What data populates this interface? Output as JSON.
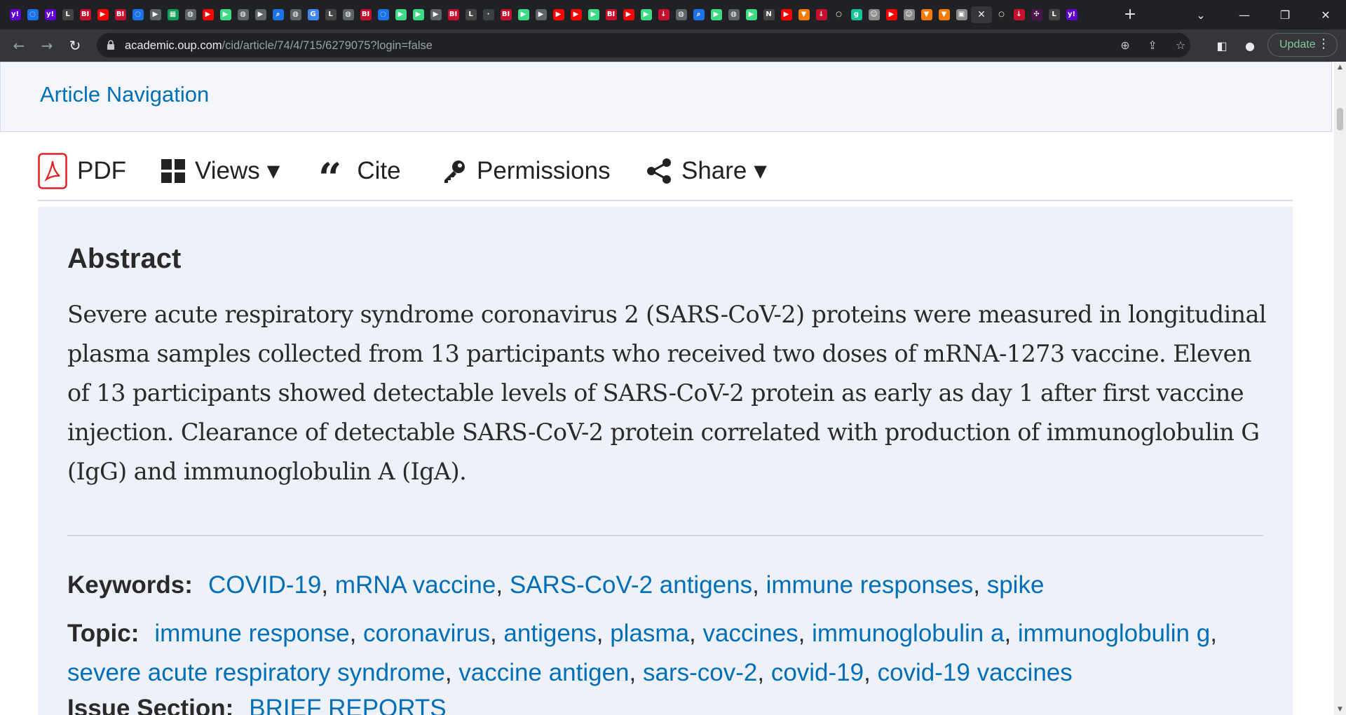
{
  "browser": {
    "tabs": [
      {
        "icon": "yahoo-icon",
        "glyph": "y!",
        "bg": "#6001d2"
      },
      {
        "icon": "shield-icon",
        "glyph": "◌",
        "bg": "#1a73e8"
      },
      {
        "icon": "yahoo-icon",
        "glyph": "y!",
        "bg": "#6001d2"
      },
      {
        "icon": "latimes-icon",
        "glyph": "L",
        "bg": "#444"
      },
      {
        "icon": "business-insider-icon",
        "glyph": "BI",
        "bg": "#c8102e"
      },
      {
        "icon": "youtube-icon",
        "glyph": "▶",
        "bg": "#ff0000"
      },
      {
        "icon": "business-insider-icon",
        "glyph": "BI",
        "bg": "#c8102e"
      },
      {
        "icon": "shield-icon",
        "glyph": "◌",
        "bg": "#1a73e8"
      },
      {
        "icon": "slides-icon",
        "glyph": "▶",
        "bg": "#5f6368"
      },
      {
        "icon": "sheets-icon",
        "glyph": "▦",
        "bg": "#0f9d58"
      },
      {
        "icon": "globe-icon",
        "glyph": "◍",
        "bg": "#5f6368"
      },
      {
        "icon": "youtube-icon",
        "glyph": "▶",
        "bg": "#ff0000"
      },
      {
        "icon": "play-icon",
        "glyph": "▶",
        "bg": "#3ddc84"
      },
      {
        "icon": "globe-icon",
        "glyph": "◍",
        "bg": "#5f6368"
      },
      {
        "icon": "slides-icon",
        "glyph": "▶",
        "bg": "#5f6368"
      },
      {
        "icon": "search-icon",
        "glyph": "⌕",
        "bg": "#1a73e8"
      },
      {
        "icon": "globe-icon",
        "glyph": "◍",
        "bg": "#5f6368"
      },
      {
        "icon": "google-icon",
        "glyph": "G",
        "bg": "#4285f4"
      },
      {
        "icon": "latimes-icon",
        "glyph": "L",
        "bg": "#444"
      },
      {
        "icon": "globe-icon",
        "glyph": "◍",
        "bg": "#5f6368"
      },
      {
        "icon": "business-insider-icon",
        "glyph": "BI",
        "bg": "#c8102e"
      },
      {
        "icon": "shield-icon",
        "glyph": "◌",
        "bg": "#1a73e8"
      },
      {
        "icon": "play-icon",
        "glyph": "▶",
        "bg": "#3ddc84"
      },
      {
        "icon": "play-icon",
        "glyph": "▶",
        "bg": "#3ddc84"
      },
      {
        "icon": "slides-icon",
        "glyph": "▶",
        "bg": "#5f6368"
      },
      {
        "icon": "business-insider-icon",
        "glyph": "BI",
        "bg": "#c8102e"
      },
      {
        "icon": "latimes-icon",
        "glyph": "L",
        "bg": "#444"
      },
      {
        "icon": "blank-icon",
        "glyph": "·",
        "bg": "#3c4043"
      },
      {
        "icon": "business-insider-icon",
        "glyph": "BI",
        "bg": "#c8102e"
      },
      {
        "icon": "play-icon",
        "glyph": "▶",
        "bg": "#3ddc84"
      },
      {
        "icon": "slides-icon",
        "glyph": "▶",
        "bg": "#5f6368"
      },
      {
        "icon": "youtube-icon",
        "glyph": "▶",
        "bg": "#ff0000"
      },
      {
        "icon": "youtube-icon",
        "glyph": "▶",
        "bg": "#ff0000"
      },
      {
        "icon": "play-icon",
        "glyph": "▶",
        "bg": "#3ddc84"
      },
      {
        "icon": "business-insider-icon",
        "glyph": "BI",
        "bg": "#c8102e"
      },
      {
        "icon": "youtube-icon",
        "glyph": "▶",
        "bg": "#ff0000"
      },
      {
        "icon": "play-icon",
        "glyph": "▶",
        "bg": "#3ddc84"
      },
      {
        "icon": "download-icon",
        "glyph": "↓",
        "bg": "#c8102e"
      },
      {
        "icon": "globe-icon",
        "glyph": "◍",
        "bg": "#5f6368"
      },
      {
        "icon": "search-icon",
        "glyph": "⌕",
        "bg": "#1a73e8"
      },
      {
        "icon": "play-icon",
        "glyph": "▶",
        "bg": "#3ddc84"
      },
      {
        "icon": "globe-icon",
        "glyph": "◍",
        "bg": "#5f6368"
      },
      {
        "icon": "play-icon",
        "glyph": "▶",
        "bg": "#3ddc84"
      },
      {
        "icon": "news-icon",
        "glyph": "N",
        "bg": "#444"
      },
      {
        "icon": "youtube-icon",
        "glyph": "▶",
        "bg": "#ff0000"
      },
      {
        "icon": "bookmark-icon",
        "glyph": "▼",
        "bg": "#f57c00"
      },
      {
        "icon": "download-icon",
        "glyph": "↓",
        "bg": "#c8102e"
      },
      {
        "icon": "circle-icon",
        "glyph": "○",
        "bg": "#222"
      },
      {
        "icon": "grammarly-icon",
        "glyph": "g",
        "bg": "#15c39a"
      },
      {
        "icon": "portrait-icon",
        "glyph": "☺",
        "bg": "#8a8a8a"
      },
      {
        "icon": "youtube-icon",
        "glyph": "▶",
        "bg": "#ff0000"
      },
      {
        "icon": "portrait-icon",
        "glyph": "☺",
        "bg": "#8a8a8a"
      },
      {
        "icon": "bookmark-icon",
        "glyph": "▼",
        "bg": "#f57c00"
      },
      {
        "icon": "bookmark-icon",
        "glyph": "▼",
        "bg": "#f57c00"
      },
      {
        "icon": "image-icon",
        "glyph": "▣",
        "bg": "#8a8a8a"
      },
      {
        "icon": "close-icon",
        "glyph": "✕",
        "bg": "transparent",
        "active": true
      },
      {
        "icon": "circle-icon",
        "glyph": "○",
        "bg": "#222"
      },
      {
        "icon": "download-icon",
        "glyph": "↓",
        "bg": "#c8102e"
      },
      {
        "icon": "slack-icon",
        "glyph": "✣",
        "bg": "#4a154b"
      },
      {
        "icon": "latimes-icon",
        "glyph": "L",
        "bg": "#444"
      },
      {
        "icon": "yahoo-icon",
        "glyph": "y!",
        "bg": "#6001d2"
      }
    ],
    "new_tab": "+",
    "url_host": "academic.oup.com",
    "url_path": "/cid/article/74/4/715/6279075?login=false",
    "update_label": "Update"
  },
  "page": {
    "article_nav": "Article Navigation",
    "actions": {
      "pdf": "PDF",
      "views": "Views",
      "cite": "Cite",
      "permissions": "Permissions",
      "share": "Share"
    },
    "abstract": {
      "title": "Abstract",
      "text": "Severe acute respiratory syndrome coronavirus 2 (SARS-CoV-2) proteins were measured in longitudinal plasma samples collected from 13 participants who received two doses of mRNA-1273 vaccine. Eleven of 13 participants showed detectable levels of SARS-CoV-2 protein as early as day 1 after first vaccine injection. Clearance of detectable SARS-CoV-2 protein correlated with production of immunoglobulin G (IgG) and immunoglobulin A (IgA)."
    },
    "keywords_label": "Keywords:",
    "keywords": [
      "COVID-19",
      "mRNA vaccine",
      "SARS-CoV-2 antigens",
      "immune responses",
      "spike"
    ],
    "topic_label": "Topic:",
    "topics": [
      "immune response",
      "coronavirus",
      "antigens",
      "plasma",
      "vaccines",
      "immunoglobulin a",
      "immunoglobulin g",
      "severe acute respiratory syndrome",
      "vaccine antigen",
      "sars-cov-2",
      "covid-19",
      "covid-19 vaccines"
    ],
    "issue_label": "Issue Section:",
    "issue_value": "BRIEF REPORTS"
  },
  "colors": {
    "link": "#006fb7",
    "pdf_red": "#e31e24",
    "abstract_bg": "#eef1f7",
    "chrome_dark": "#202124"
  }
}
